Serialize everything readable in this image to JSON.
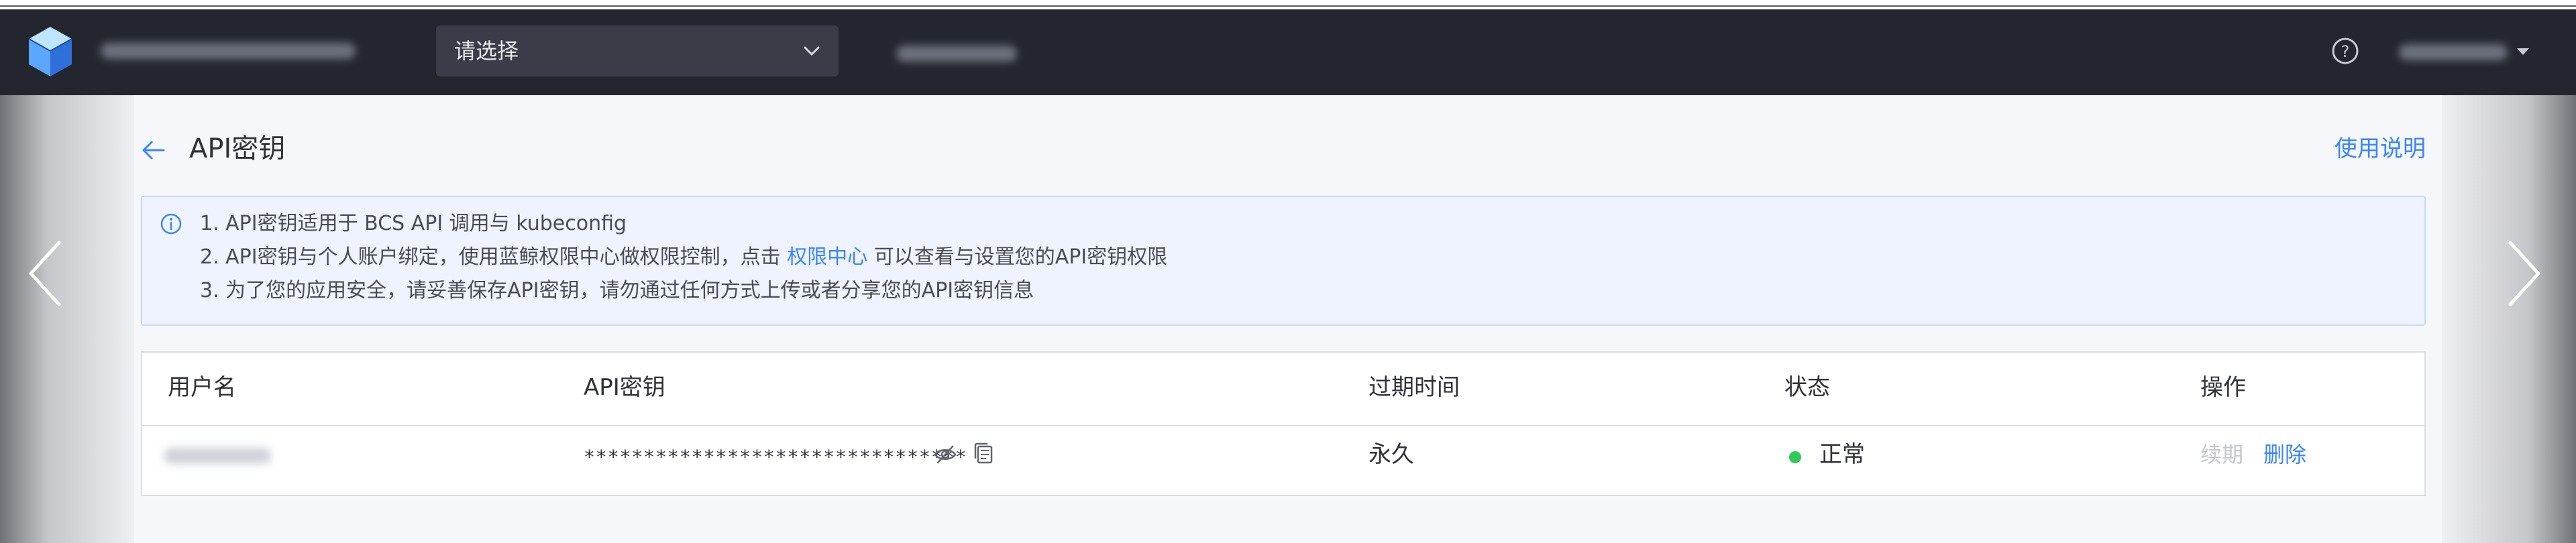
{
  "header": {
    "brand": "",
    "project_select": {
      "value": "请选择"
    },
    "user_name": ""
  },
  "page": {
    "title": "API密钥",
    "usage_link": "使用说明"
  },
  "notice": {
    "line1": "1. API密钥适用于 BCS API 调用与 kubeconfig",
    "line2_before": "2. API密钥与个人账户绑定，使用蓝鲸权限中心做权限控制，点击 ",
    "line2_link": "权限中心",
    "line2_after": " 可以查看与设置您的API密钥权限",
    "line3": "3. 为了您的应用安全，请妥善保存API密钥，请勿通过任何方式上传或者分享您的API密钥信息"
  },
  "table": {
    "headers": [
      "用户名",
      "API密钥",
      "过期时间",
      "状态",
      "操作"
    ],
    "rows": [
      {
        "username": "",
        "api_key_masked": "********************************",
        "expire": "永久",
        "status": "正常",
        "actions": [
          "续期",
          "删除"
        ]
      }
    ]
  },
  "colors": {
    "header_bg": "#24262f",
    "accent": "#3a84ff",
    "status_ok": "#2dcb56",
    "disabled": "#c4c6cc"
  },
  "icons": {
    "logo": "cube-logo-icon",
    "dropdown": "chevron-down-icon",
    "help": "question-circle-icon",
    "back": "arrow-left-icon",
    "info": "info-circle-icon",
    "view": "eye-slash-icon",
    "copy": "copy-icon",
    "prev": "chevron-left-icon",
    "next": "chevron-right-icon"
  }
}
